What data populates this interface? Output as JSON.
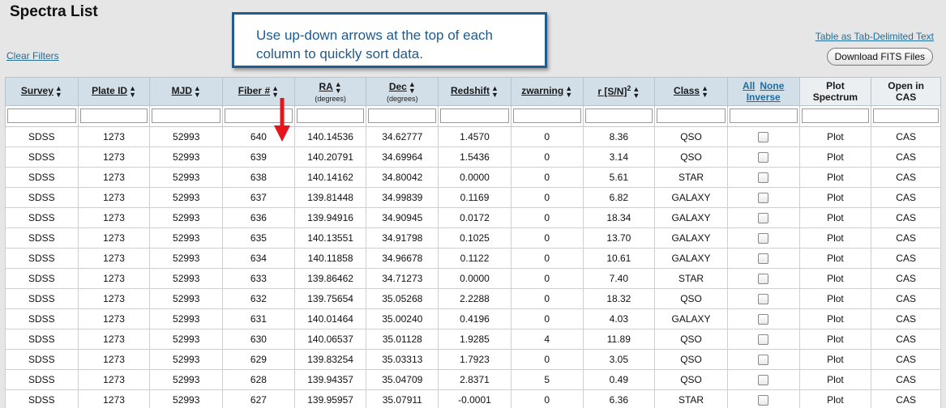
{
  "page": {
    "title": "Spectra List",
    "clear_filters": "Clear Filters",
    "tab_delimited_link": "Table as Tab-Delimited Text",
    "download_button": "Download FITS Files"
  },
  "callout": {
    "line1": "Use up-down arrows at the top of each",
    "line2": "column to quickly sort data."
  },
  "colors": {
    "header_bg": "#d2dfe9",
    "link": "#1f6e9c",
    "callout_border": "#205d8f",
    "arrow": "#e8141b"
  },
  "table": {
    "columns": [
      {
        "label": "Survey",
        "sub": "",
        "sort": true
      },
      {
        "label": "Plate ID",
        "sub": "",
        "sort": true
      },
      {
        "label": "MJD",
        "sub": "",
        "sort": true
      },
      {
        "label": "Fiber #",
        "sub": "",
        "sort": true
      },
      {
        "label": "RA",
        "sub": "(degrees)",
        "sort": true
      },
      {
        "label": "Dec",
        "sub": "(degrees)",
        "sort": true
      },
      {
        "label": "Redshift",
        "sub": "",
        "sort": true
      },
      {
        "label": "zwarning",
        "sub": "",
        "sort": true
      },
      {
        "label": "r [S/N]",
        "sup": "2",
        "sub": "",
        "sort": true
      },
      {
        "label": "Class",
        "sub": "",
        "sort": true
      }
    ],
    "select_header": {
      "all": "All",
      "none": "None",
      "inverse": "Inverse"
    },
    "plot_header": {
      "line1": "Plot",
      "line2": "Spectrum"
    },
    "cas_header": {
      "line1": "Open in",
      "line2": "CAS"
    },
    "plot_label": "Plot",
    "cas_label": "CAS",
    "rows": [
      [
        "SDSS",
        "1273",
        "52993",
        "640",
        "140.14536",
        "34.62777",
        "1.4570",
        "0",
        "8.36",
        "QSO"
      ],
      [
        "SDSS",
        "1273",
        "52993",
        "639",
        "140.20791",
        "34.69964",
        "1.5436",
        "0",
        "3.14",
        "QSO"
      ],
      [
        "SDSS",
        "1273",
        "52993",
        "638",
        "140.14162",
        "34.80042",
        "0.0000",
        "0",
        "5.61",
        "STAR"
      ],
      [
        "SDSS",
        "1273",
        "52993",
        "637",
        "139.81448",
        "34.99839",
        "0.1169",
        "0",
        "6.82",
        "GALAXY"
      ],
      [
        "SDSS",
        "1273",
        "52993",
        "636",
        "139.94916",
        "34.90945",
        "0.0172",
        "0",
        "18.34",
        "GALAXY"
      ],
      [
        "SDSS",
        "1273",
        "52993",
        "635",
        "140.13551",
        "34.91798",
        "0.1025",
        "0",
        "13.70",
        "GALAXY"
      ],
      [
        "SDSS",
        "1273",
        "52993",
        "634",
        "140.11858",
        "34.96678",
        "0.1122",
        "0",
        "10.61",
        "GALAXY"
      ],
      [
        "SDSS",
        "1273",
        "52993",
        "633",
        "139.86462",
        "34.71273",
        "0.0000",
        "0",
        "7.40",
        "STAR"
      ],
      [
        "SDSS",
        "1273",
        "52993",
        "632",
        "139.75654",
        "35.05268",
        "2.2288",
        "0",
        "18.32",
        "QSO"
      ],
      [
        "SDSS",
        "1273",
        "52993",
        "631",
        "140.01464",
        "35.00240",
        "0.4196",
        "0",
        "4.03",
        "GALAXY"
      ],
      [
        "SDSS",
        "1273",
        "52993",
        "630",
        "140.06537",
        "35.01128",
        "1.9285",
        "4",
        "11.89",
        "QSO"
      ],
      [
        "SDSS",
        "1273",
        "52993",
        "629",
        "139.83254",
        "35.03313",
        "1.7923",
        "0",
        "3.05",
        "QSO"
      ],
      [
        "SDSS",
        "1273",
        "52993",
        "628",
        "139.94357",
        "35.04709",
        "2.8371",
        "5",
        "0.49",
        "QSO"
      ],
      [
        "SDSS",
        "1273",
        "52993",
        "627",
        "139.95957",
        "35.07911",
        "-0.0001",
        "0",
        "6.36",
        "STAR"
      ]
    ]
  }
}
